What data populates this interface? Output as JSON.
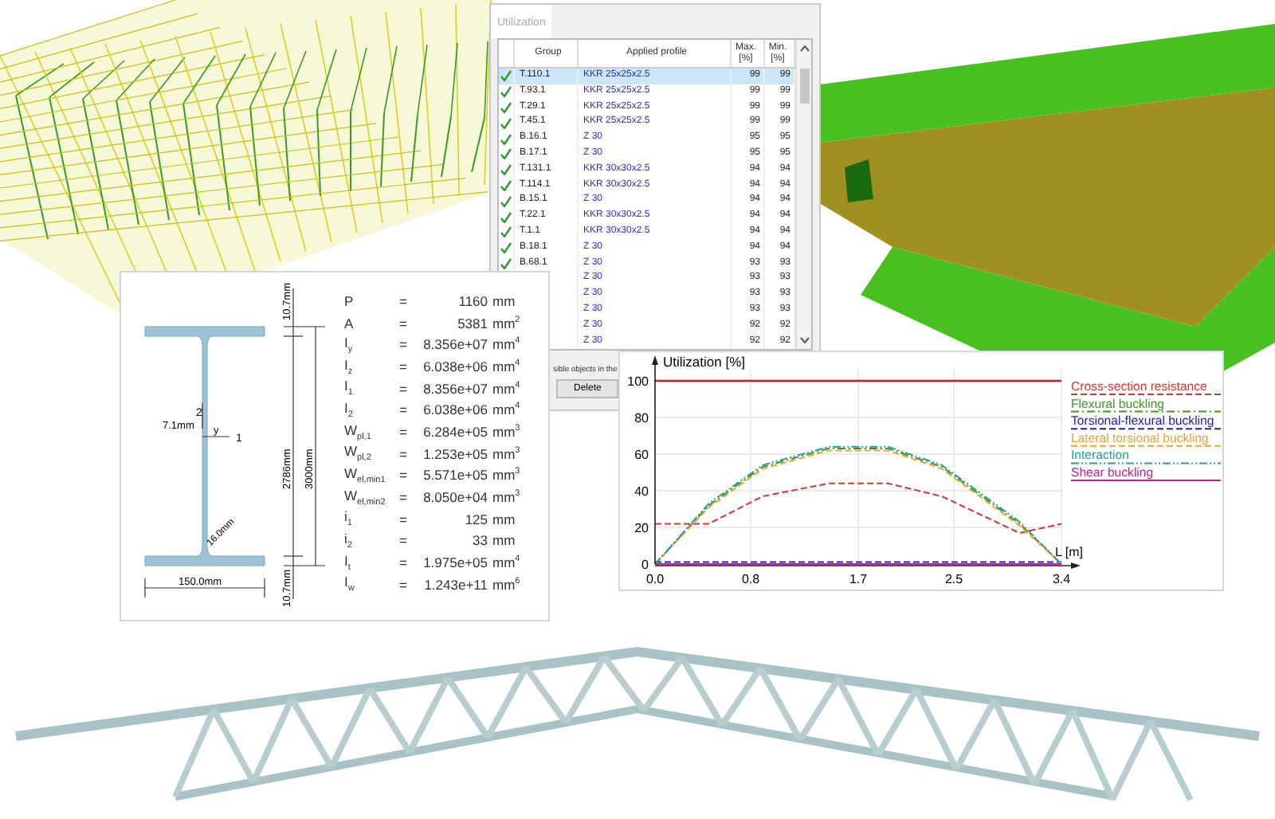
{
  "utilization_window": {
    "title": "Utilization",
    "columns": [
      "Group",
      "Applied profile",
      "Max. [%]",
      "Min. [%]"
    ],
    "rows": [
      {
        "ok": true,
        "selected": true,
        "group": "T.110.1",
        "profile": "KKR 25x25x2.5",
        "max": "99",
        "min": "99"
      },
      {
        "ok": true,
        "selected": false,
        "group": "T.93.1",
        "profile": "KKR 25x25x2.5",
        "max": "99",
        "min": "99"
      },
      {
        "ok": true,
        "selected": false,
        "group": "T.29.1",
        "profile": "KKR 25x25x2.5",
        "max": "99",
        "min": "99"
      },
      {
        "ok": true,
        "selected": false,
        "group": "T.45.1",
        "profile": "KKR 25x25x2.5",
        "max": "99",
        "min": "99"
      },
      {
        "ok": true,
        "selected": false,
        "group": "B.16.1",
        "profile": "Z 30",
        "max": "95",
        "min": "95"
      },
      {
        "ok": true,
        "selected": false,
        "group": "B.17.1",
        "profile": "Z 30",
        "max": "95",
        "min": "95"
      },
      {
        "ok": true,
        "selected": false,
        "group": "T.131.1",
        "profile": "KKR 30x30x2.5",
        "max": "94",
        "min": "94"
      },
      {
        "ok": true,
        "selected": false,
        "group": "T.114.1",
        "profile": "KKR 30x30x2.5",
        "max": "94",
        "min": "94"
      },
      {
        "ok": true,
        "selected": false,
        "group": "B.15.1",
        "profile": "Z 30",
        "max": "94",
        "min": "94"
      },
      {
        "ok": true,
        "selected": false,
        "group": "T.22.1",
        "profile": "KKR 30x30x2.5",
        "max": "94",
        "min": "94"
      },
      {
        "ok": true,
        "selected": false,
        "group": "T.1.1",
        "profile": "KKR 30x30x2.5",
        "max": "94",
        "min": "94"
      },
      {
        "ok": true,
        "selected": false,
        "group": "B.18.1",
        "profile": "Z 30",
        "max": "94",
        "min": "94"
      },
      {
        "ok": true,
        "selected": false,
        "group": "B.68.1",
        "profile": "Z 30",
        "max": "93",
        "min": "93"
      },
      {
        "selected": false,
        "profile": "Z 30",
        "max": "93",
        "min": "93"
      },
      {
        "selected": false,
        "profile": "Z 30",
        "max": "93",
        "min": "93"
      },
      {
        "selected": false,
        "profile": "Z 30",
        "max": "93",
        "min": "93"
      },
      {
        "selected": false,
        "profile": "Z 30",
        "max": "92",
        "min": "92"
      },
      {
        "selected": false,
        "profile": "Z 30",
        "max": "92",
        "min": "92"
      }
    ],
    "footer_text": "sible objects in the",
    "delete_button": "Delete"
  },
  "section_panel": {
    "dimensions": {
      "top_flange": "10.7mm",
      "web_height": "2786mm",
      "total_height": "3000mm",
      "web_thickness": "7.1mm",
      "axis_2": "2",
      "axis_y": "y",
      "axis_1": "1",
      "fillet": "16.0mm",
      "bottom_flange": "10.7mm",
      "width": "150.0mm"
    },
    "properties": [
      {
        "symbol": "P",
        "eq": "=",
        "value": "1160",
        "unit": "mm"
      },
      {
        "symbol": "A",
        "eq": "=",
        "value": "5381",
        "unit": "mm$^{2}$"
      },
      {
        "symbol": "I$_{y}$",
        "eq": "=",
        "value": "8.356e+07",
        "unit": "mm$^{4}$"
      },
      {
        "symbol": "I$_{z}$",
        "eq": "=",
        "value": "6.038e+06",
        "unit": "mm$^{4}$"
      },
      {
        "symbol": "I$_{1}$",
        "eq": "=",
        "value": "8.356e+07",
        "unit": "mm$^{4}$"
      },
      {
        "symbol": "I$_{2}$",
        "eq": "=",
        "value": "6.038e+06",
        "unit": "mm$^{4}$"
      },
      {
        "symbol": "W$_{pl,1}$",
        "eq": "=",
        "value": "6.284e+05",
        "unit": "mm$^{3}$"
      },
      {
        "symbol": "W$_{pl,2}$",
        "eq": "=",
        "value": "1.253e+05",
        "unit": "mm$^{3}$"
      },
      {
        "symbol": "W$_{el,min1}$",
        "eq": "=",
        "value": "5.571e+05",
        "unit": "mm$^{3}$"
      },
      {
        "symbol": "W$_{el,min2}$",
        "eq": "=",
        "value": "8.050e+04",
        "unit": "mm$^{3}$"
      },
      {
        "symbol": "i$_{1}$",
        "eq": "=",
        "value": "125",
        "unit": "mm"
      },
      {
        "symbol": "i$_{2}$",
        "eq": "=",
        "value": "33",
        "unit": "mm"
      },
      {
        "symbol": "I$_{t}$",
        "eq": "=",
        "value": "1.975e+05",
        "unit": "mm$^{4}$"
      },
      {
        "symbol": "I$_{w}$",
        "eq": "=",
        "value": "1.243e+11",
        "unit": "mm$^{6}$"
      }
    ]
  },
  "utilization_chart": {
    "chart_data": {
      "type": "line",
      "ylabel": "Utilization [%]",
      "xlabel": "L [m]",
      "x": [
        0,
        0.45,
        0.9,
        1.45,
        1.95,
        2.4,
        3.05,
        3.4
      ],
      "xlim": [
        0,
        3.4
      ],
      "ylim": [
        0,
        100
      ],
      "xticks": [
        {
          "value": 0,
          "label": "0.0"
        },
        {
          "value": 0.8,
          "label": "0.8"
        },
        {
          "value": 1.7,
          "label": "1.7"
        },
        {
          "value": 2.5,
          "label": "2.5"
        },
        {
          "value": 3.4,
          "label": "3.4"
        }
      ],
      "yticks": [
        0,
        20,
        40,
        60,
        80,
        100
      ],
      "grid": true,
      "ref_lines": [
        {
          "axis": "y",
          "value": 100,
          "color": "#e81010"
        }
      ],
      "series": [
        {
          "name": "Cross-section resistance",
          "color": "#e03030",
          "line_style": "dashed",
          "values": [
            22,
            22,
            37,
            44,
            44,
            37,
            17,
            22
          ]
        },
        {
          "name": "Flexural buckling",
          "color": "#3a9a20",
          "line_style": "dashdot",
          "values": [
            0,
            32,
            53,
            63,
            63,
            53,
            22,
            0
          ]
        },
        {
          "name": "Torsional-flexural buckling",
          "color": "#2020c0",
          "line_style": "dashed",
          "values": [
            1,
            1,
            1,
            1,
            1,
            1,
            1,
            1
          ]
        },
        {
          "name": "Lateral torsional buckling",
          "color": "#f0a030",
          "line_style": "dashed",
          "values": [
            0,
            31,
            52,
            62,
            62,
            52,
            21,
            0
          ]
        },
        {
          "name": "Interaction",
          "color": "#20a0a0",
          "line_style": "dashdotdot",
          "values": [
            0,
            33,
            54,
            64,
            64,
            54,
            23,
            0
          ]
        },
        {
          "name": "Shear buckling",
          "color": "#c02090",
          "line_style": "solid",
          "values": [
            0,
            0,
            0,
            0,
            0,
            0,
            0,
            0
          ]
        }
      ]
    }
  }
}
